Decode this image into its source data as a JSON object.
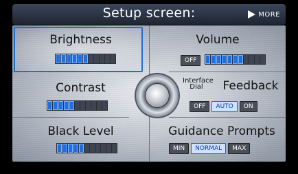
{
  "header": {
    "title": "Setup screen:",
    "more_label": "MORE"
  },
  "settings": {
    "brightness": {
      "label": "Brightness",
      "level": 6,
      "segments": 11
    },
    "volume": {
      "label": "Volume",
      "off_label": "OFF",
      "level": 7,
      "segments": 11
    },
    "contrast": {
      "label": "Contrast",
      "level": 5,
      "segments": 11
    },
    "interface_dial_feedback": {
      "label_small": "Interface Dial",
      "label": "Feedback",
      "options": [
        "OFF",
        "AUTO",
        "ON"
      ],
      "selected": "AUTO"
    },
    "black_level": {
      "label": "Black Level",
      "level": 5,
      "segments": 11
    },
    "guidance_prompts": {
      "label": "Guidance Prompts",
      "options": [
        "MIN",
        "NORMAL",
        "MAX"
      ],
      "selected": "NORMAL"
    }
  },
  "colors": {
    "highlight": "#1f6fcf",
    "meter_on": "#1f6fdf"
  }
}
